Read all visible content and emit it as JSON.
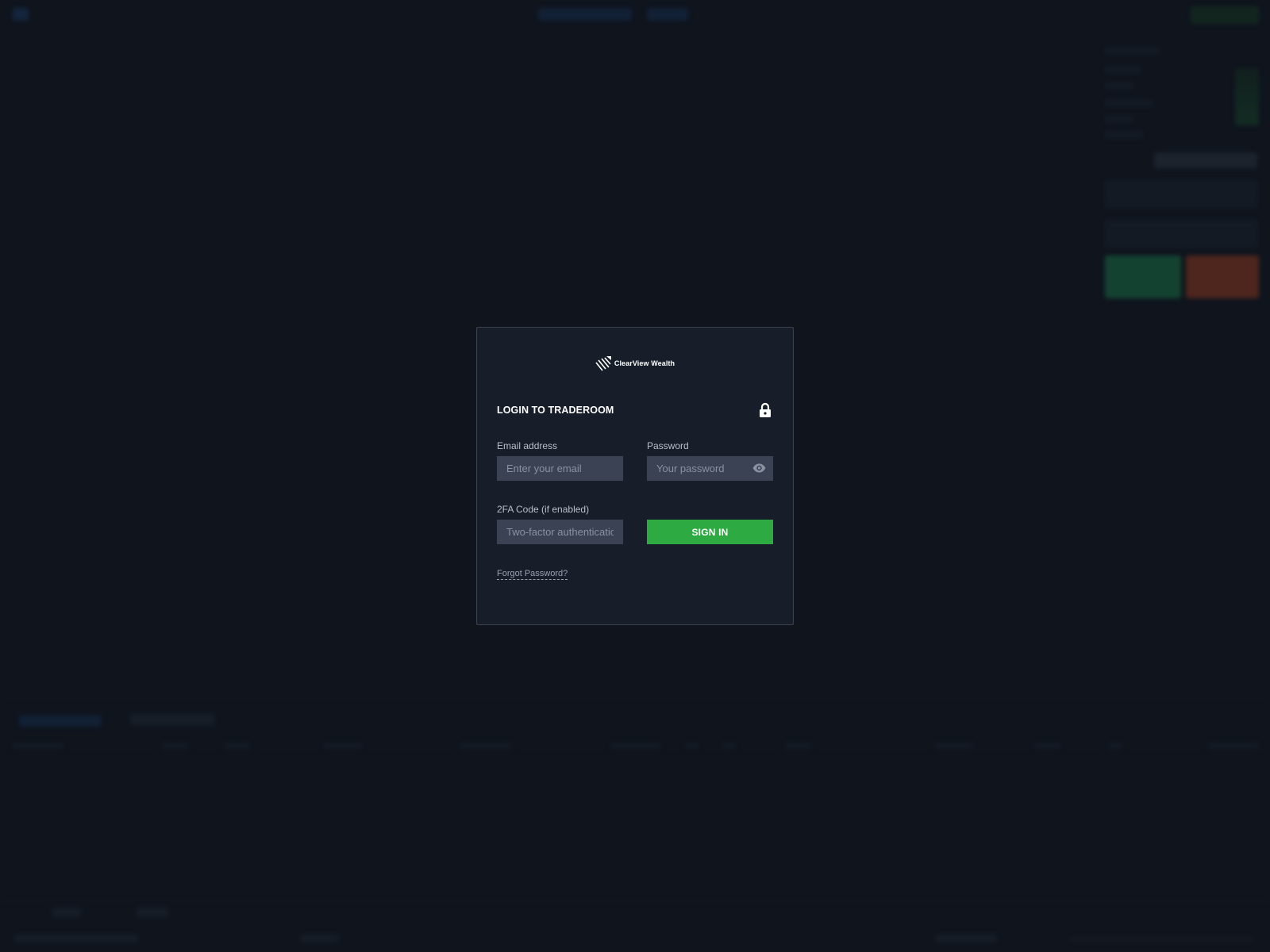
{
  "login": {
    "brand_name": "ClearView Wealth",
    "title": "LOGIN TO TRADEROOM",
    "email_label": "Email address",
    "email_placeholder": "Enter your email",
    "password_label": "Password",
    "password_placeholder": "Your password",
    "twofa_label": "2FA Code (if enabled)",
    "twofa_placeholder": "Two-factor authentication code",
    "signin_label": "SIGN IN",
    "forgot_label": "Forgot Password?"
  },
  "colors": {
    "background": "#131823",
    "modal_bg": "#171e2a",
    "input_bg": "#3a4253",
    "signin_green": "#2daa42",
    "buy_green": "#1f9a5a",
    "sell_orange": "#c24a22"
  },
  "icons": {
    "logo": "clearview-logo-icon",
    "lock": "lock-icon",
    "eye": "eye-icon"
  }
}
